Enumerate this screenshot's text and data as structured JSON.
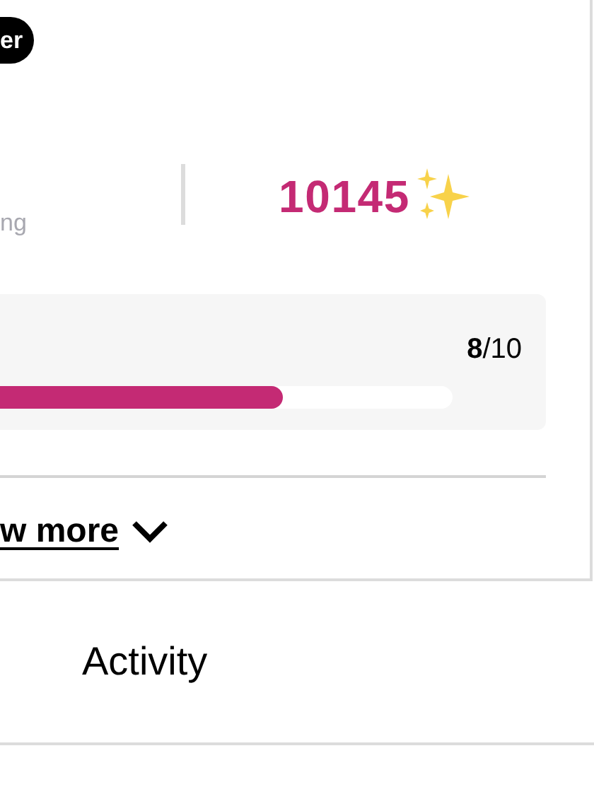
{
  "badge": {
    "label": "er"
  },
  "stats": {
    "left_caption": "ng",
    "points": "10145"
  },
  "progress": {
    "count": "**8**/10",
    "level": 0.625
  },
  "show_more": {
    "label": "w more",
    "expanded": false
  },
  "tabs": [
    {
      "label": "Activity",
      "selected": false
    }
  ]
}
